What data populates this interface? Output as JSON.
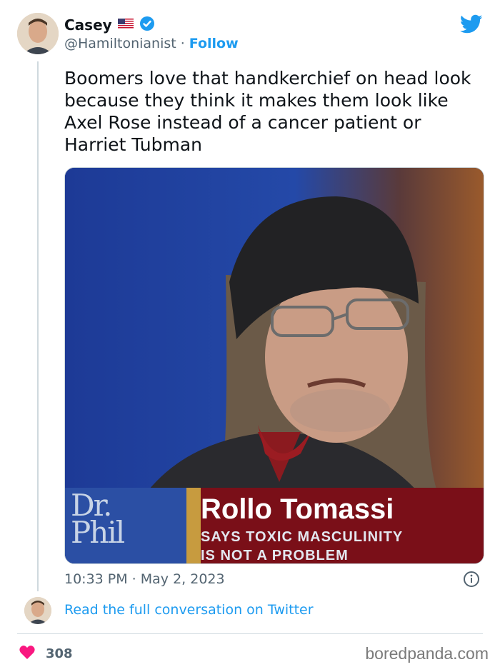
{
  "tweet": {
    "author_name": "Casey",
    "flag_icon": "us-flag-icon",
    "verified_icon": "verified-badge-icon",
    "handle": "@Hamiltonianist",
    "separator": "·",
    "follow_label": "Follow",
    "text": "Boomers love that handkerchief on head look because they think it makes them look like Axel Rose instead of a cancer patient or Harriet Tubman",
    "time": "10:33 PM · May 2, 2023",
    "read_more": "Read the full conversation on Twitter",
    "like_count": "308"
  },
  "media": {
    "logo_line1": "Dr.",
    "logo_line2": "Phil",
    "caption_name": "Rollo Tomassi",
    "caption_sub_line1": "SAYS TOXIC MASCULINITY",
    "caption_sub_line2": "IS NOT A PROBLEM"
  },
  "watermark": "boredpanda.com",
  "colors": {
    "accent": "#1d9bf0",
    "like": "#f91880",
    "text_secondary": "#536471"
  }
}
